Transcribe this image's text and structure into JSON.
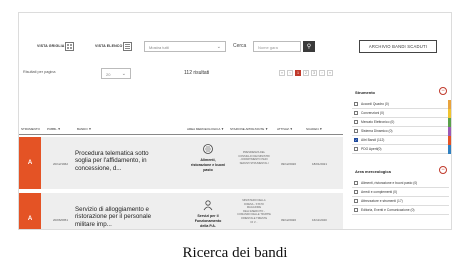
{
  "toolbar": {
    "grid_view_label": "VISTA GRIGLIA",
    "list_view_label": "VISTA ELENCO",
    "filter_select_value": "Mostra tutti",
    "search_label": "Cerca",
    "search_placeholder": "Nome gara",
    "archive_button_label": "ARCHIVIO BANDI SCADUTI"
  },
  "results": {
    "per_page_label": "Risultati per pagina",
    "per_page_value": "20",
    "count_text": "112 risultati",
    "pages": [
      "«",
      "‹",
      "1",
      "2",
      "3",
      "›",
      "»"
    ],
    "active_page": "1"
  },
  "table": {
    "headers": [
      "STRUMENTO",
      "PUBBL.▼",
      "BANDO ▼",
      "AREA MERCEOLOGICA ▼",
      "STAZIONE APPALTANTE ▼",
      "ATTIVAZ.▼",
      "SCADEN.▼"
    ],
    "rows": [
      {
        "strumento": "A",
        "pubbl": "20/12/1962",
        "title_lines": [
          "Procedura telematica sotto",
          "soglia per l'affidamento, in",
          "concessione, d..."
        ],
        "category_lines": [
          "Alimenti,",
          "ristorazione e buoni",
          "pasto"
        ],
        "institution_lines": [
          "PRESIDENZA DEL",
          "CONSIGLIO DEI MINISTRI",
          "- DIPARTIMENTO PER I",
          "SERVIZI STRUMENTALI"
        ],
        "attivazione": "09/12/2020",
        "scadenza": "18/01/2021"
      },
      {
        "strumento": "A",
        "pubbl": "20/06/0951",
        "title_lines": [
          "Servizio di alloggiamento e",
          "ristorazione per il personale",
          "militare imp..."
        ],
        "category_lines": [
          "Servizi per il",
          "Funzionamento",
          "della P.A."
        ],
        "institution_lines": [
          "MINISTERO DELLA",
          "DIFESA - STATO",
          "MAGGIORE",
          "DELL'ESERCITO -",
          "COMANDO DELLE TRUPPE",
          "ORIENTALE TRIESTE",
          "DI V..."
        ],
        "attivazione": "09/12/2020",
        "scadenza": "16/11/2020"
      }
    ]
  },
  "sidebar": {
    "strumento_title": "Strumento",
    "strumento_toggle": "−",
    "strumento_items": [
      {
        "label": "Accordi Quadro (0)",
        "checked": false,
        "color": "#e8a33d"
      },
      {
        "label": "Convenzioni (0)",
        "checked": false,
        "color": "#f0c330"
      },
      {
        "label": "Mercato Elettronico (0)",
        "checked": false,
        "color": "#5aa04a"
      },
      {
        "label": "Sistema Dinamico (0)",
        "checked": false,
        "color": "#9b59b6"
      },
      {
        "label": "Altri Bandi (112)",
        "checked": true,
        "color": "#e45325"
      },
      {
        "label": "PDO Aperti(0)",
        "checked": false,
        "color": "#2f80c0"
      }
    ],
    "area_title": "Area merceologica",
    "area_toggle": "−",
    "area_items": [
      {
        "label": "Alimenti, ristorazione e buoni pasto (0)"
      },
      {
        "label": "Arredi e complementi (0)"
      },
      {
        "label": "Attrezzature e strumenti (17)"
      },
      {
        "label": "Editoria, Eventi e Comunicazione (0)"
      }
    ]
  },
  "caption": "Ricerca dei bandi"
}
